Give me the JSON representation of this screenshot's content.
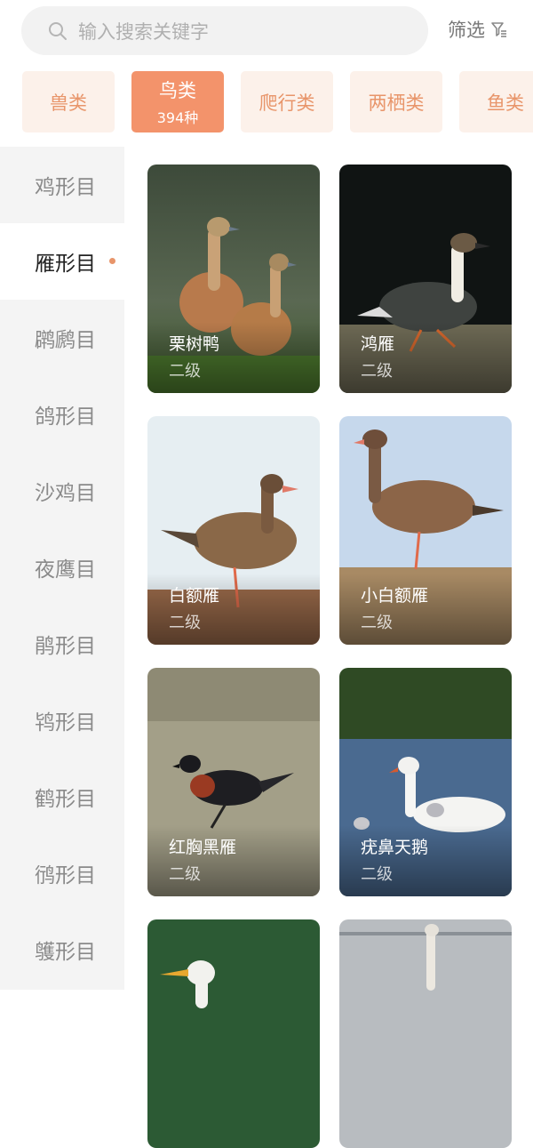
{
  "search": {
    "placeholder": "输入搜索关键字"
  },
  "filter": {
    "label": "筛选"
  },
  "categories": [
    {
      "label": "兽类"
    },
    {
      "label": "鸟类",
      "count": "394种",
      "active": true
    },
    {
      "label": "爬行类"
    },
    {
      "label": "两栖类"
    },
    {
      "label": "鱼类"
    }
  ],
  "sidebar": [
    {
      "label": "鸡形目"
    },
    {
      "label": "雁形目",
      "active": true
    },
    {
      "label": "䴙䴘目"
    },
    {
      "label": "鸽形目"
    },
    {
      "label": "沙鸡目"
    },
    {
      "label": "夜鹰目"
    },
    {
      "label": "鹃形目"
    },
    {
      "label": "鸨形目"
    },
    {
      "label": "鹤形目"
    },
    {
      "label": "鸻形目"
    },
    {
      "label": "鹱形目"
    }
  ],
  "cards": [
    {
      "name": "栗树鸭",
      "level": "二级"
    },
    {
      "name": "鸿雁",
      "level": "二级"
    },
    {
      "name": "白额雁",
      "level": "二级"
    },
    {
      "name": "小白额雁",
      "level": "二级"
    },
    {
      "name": "红胸黑雁",
      "level": "二级"
    },
    {
      "name": "疣鼻天鹅",
      "level": "二级"
    }
  ],
  "colors": {
    "accent": "#f3936b",
    "accent_light": "#fcf1ea",
    "sidebar_bg": "#f4f4f4"
  }
}
